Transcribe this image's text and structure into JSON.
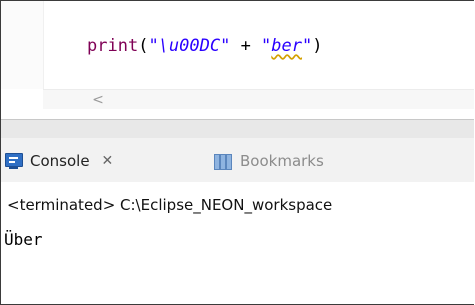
{
  "editor": {
    "code": {
      "func": "print",
      "open": "(",
      "str1": "\"\\u00DC\"",
      "plus": " + ",
      "quote_open": "\"",
      "str2_word": "ber",
      "quote_close": "\"",
      "close": ")"
    },
    "scroll_left_glyph": "<"
  },
  "console_view": {
    "tabs": [
      {
        "label": "Console",
        "icon": "console-icon",
        "close": "✕"
      },
      {
        "label": "Bookmarks",
        "icon": "bookmarks-icon"
      }
    ],
    "terminated_line": "<terminated> C:\\Eclipse_NEON_workspace",
    "output": "Über"
  },
  "colors": {
    "keyword": "#7f0055",
    "string": "#2a00ff",
    "console_icon": "#2f6fc4"
  }
}
